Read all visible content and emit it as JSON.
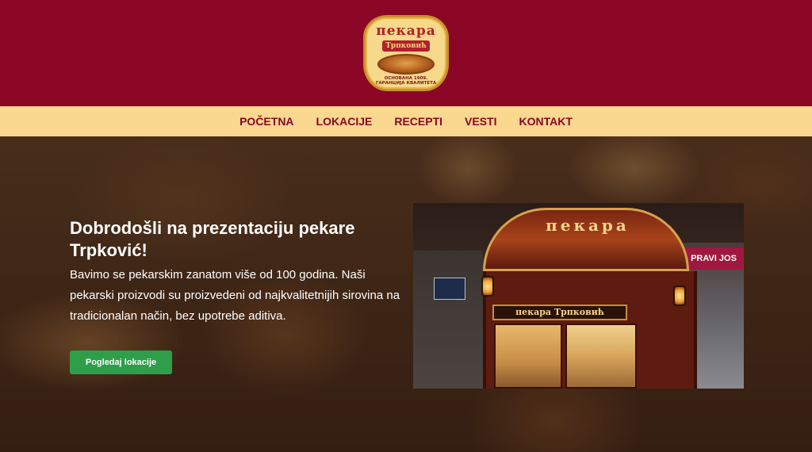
{
  "header": {
    "logo": {
      "title": "пекара",
      "subtitle": "Трпковић",
      "tagline": "ОСНОВАНА 1909. ГАРАНЦИЈА КВАЛИТЕТА"
    },
    "background_color": "#8b0624"
  },
  "nav": {
    "items": [
      {
        "label": "POČETNA"
      },
      {
        "label": "LOKACIJE"
      },
      {
        "label": "RECEPTI"
      },
      {
        "label": "VESTI"
      },
      {
        "label": "KONTAKT"
      }
    ],
    "background_color": "#fbd88f",
    "text_color": "#8b0624"
  },
  "hero": {
    "title": "Dobrodošli na prezentaciju pekare Trpković!",
    "text": "Bavimo se pekarskim zanatom više od 100 godina. Naši pekarski proizvodi su proizvedeni od najkvalitetnijih sirovina na tradicionalan način, bez upotrebe aditiva.",
    "button_label": "Pogledaj lokacije",
    "button_color": "#2e9e4a"
  },
  "photo": {
    "arch_text": "пекара",
    "store_sign": "пекара   Трпковић",
    "side_sign": "PRAVI JOS"
  }
}
